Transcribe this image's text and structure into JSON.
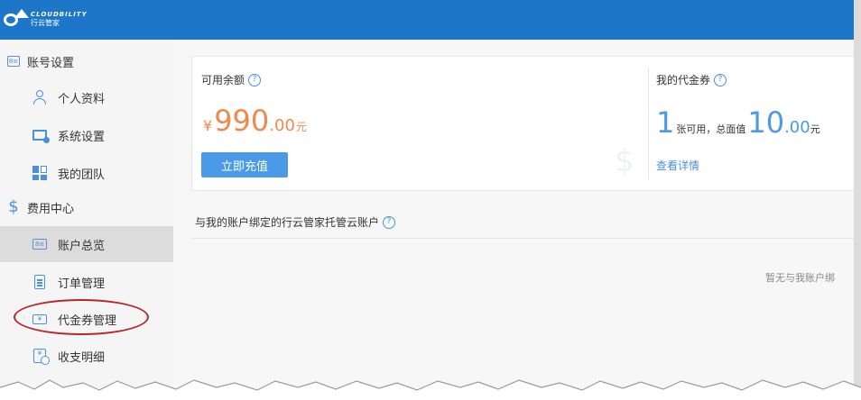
{
  "brand": {
    "name_en": "CLOUDBILITY",
    "name_cn": "行云管家"
  },
  "sidebar": {
    "account_settings": "账号设置",
    "items_account": [
      {
        "label": "个人资料"
      },
      {
        "label": "系统设置"
      },
      {
        "label": "我的团队"
      }
    ],
    "billing_center": "费用中心",
    "items_billing": [
      {
        "label": "账户总览"
      },
      {
        "label": "订单管理"
      },
      {
        "label": "代金券管理"
      },
      {
        "label": "收支明细"
      }
    ]
  },
  "balance": {
    "label": "可用余额",
    "currency": "¥",
    "integer": "990",
    "decimal": ".00",
    "unit": "元",
    "recharge_button": "立即充值"
  },
  "coupon": {
    "label": "我的代金券",
    "count": "1",
    "count_text": "张可用，总面值",
    "total_integer": "10",
    "total_decimal": ".00",
    "unit": "元",
    "view_detail": "查看详情"
  },
  "bound_accounts": {
    "title": "与我的账户绑定的行云管家托管云账户",
    "empty_text": "暂无与我账户绑"
  },
  "help_glyph": "?",
  "colors": {
    "topbar": "#1e76c8",
    "accent_orange": "#f08a4b",
    "accent_blue": "#4a9ae8",
    "highlight_red": "#b5252a"
  }
}
